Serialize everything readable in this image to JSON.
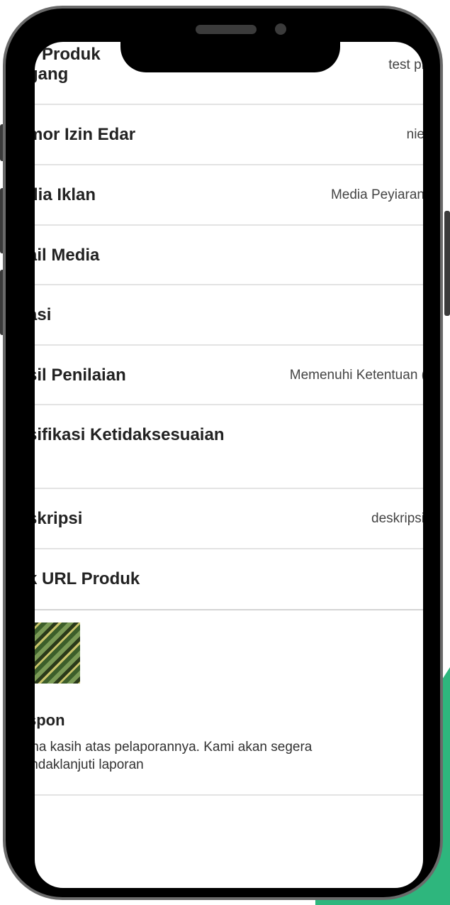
{
  "rows": [
    {
      "label_line1": "a Produk",
      "label_line2": "gang",
      "value": "test pr"
    },
    {
      "label": "mor Izin Edar",
      "value": "nie"
    },
    {
      "label": "dia Iklan",
      "value": "Media Peyiaran"
    },
    {
      "label": "ail Media",
      "value": ""
    },
    {
      "label": "asi",
      "value": ""
    },
    {
      "label": "sil Penilaian",
      "value": "Memenuhi Ketentuan ("
    },
    {
      "label": "sifikasi Ketidaksesuaian",
      "value": ""
    },
    {
      "label": "skripsi",
      "value": "deskripsi"
    },
    {
      "label": "k URL Produk",
      "value": ""
    }
  ],
  "attachment": {
    "icon": "image-thumbnail"
  },
  "respon": {
    "label": "spon",
    "text_line1": "ma kasih atas pelaporannya. Kami akan segera",
    "text_line2": "indaklanjuti laporan"
  },
  "colors": {
    "accent": "#2eb67d",
    "frame": "#000000",
    "divider": "#e3e3e3"
  }
}
